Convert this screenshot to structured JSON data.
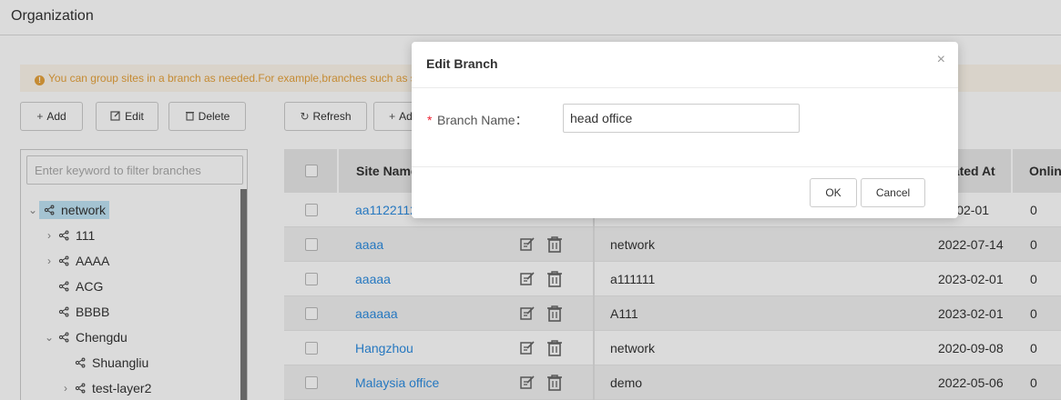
{
  "page": {
    "title": "Organization"
  },
  "tip": {
    "icon": "info-icon",
    "text": "You can group sites in a branch as needed.For example,branches such as s"
  },
  "tree_toolbar": {
    "add_label": "Add",
    "edit_label": "Edit",
    "delete_label": "Delete"
  },
  "site_toolbar": {
    "refresh_label": "Refresh",
    "add_label": "Ad"
  },
  "tree": {
    "filter_placeholder": "Enter keyword to filter branches",
    "nodes": [
      {
        "label": "network",
        "expanded": true,
        "selected": true,
        "has_children": true
      },
      {
        "label": "111",
        "expanded": false,
        "has_children": true
      },
      {
        "label": "AAAA",
        "expanded": false,
        "has_children": true
      },
      {
        "label": "ACG",
        "has_children": false
      },
      {
        "label": "BBBB",
        "has_children": false
      },
      {
        "label": "Chengdu",
        "expanded": true,
        "has_children": true
      },
      {
        "label": "Shuangliu",
        "has_children": false
      },
      {
        "label": "test-layer2",
        "expanded": false,
        "has_children": true
      }
    ]
  },
  "table": {
    "columns": {
      "site_name": "Site Name",
      "created_at": "eated At",
      "online": "Onlin"
    },
    "rows": [
      {
        "site_name": "aa11221122",
        "branch": "",
        "created_at": "23-02-01",
        "online": "0"
      },
      {
        "site_name": "aaaa",
        "branch": "network",
        "created_at": "2022-07-14",
        "online": "0"
      },
      {
        "site_name": "aaaaa",
        "branch": "a111111",
        "created_at": "2023-02-01",
        "online": "0"
      },
      {
        "site_name": "aaaaaa",
        "branch": "A111",
        "created_at": "2023-02-01",
        "online": "0"
      },
      {
        "site_name": "Hangzhou",
        "branch": "network",
        "created_at": "2020-09-08",
        "online": "0"
      },
      {
        "site_name": "Malaysia office",
        "branch": "demo",
        "created_at": "2022-05-06",
        "online": "0"
      }
    ]
  },
  "modal": {
    "title": "Edit Branch",
    "close_icon": "close-icon",
    "field_label": "Branch Name：",
    "field_value": "head office",
    "ok_label": "OK",
    "cancel_label": "Cancel"
  },
  "colors": {
    "link": "#2d8ce0",
    "warning": "#e6a23c",
    "required": "#e23",
    "selected_node": "#bfe3f5"
  }
}
